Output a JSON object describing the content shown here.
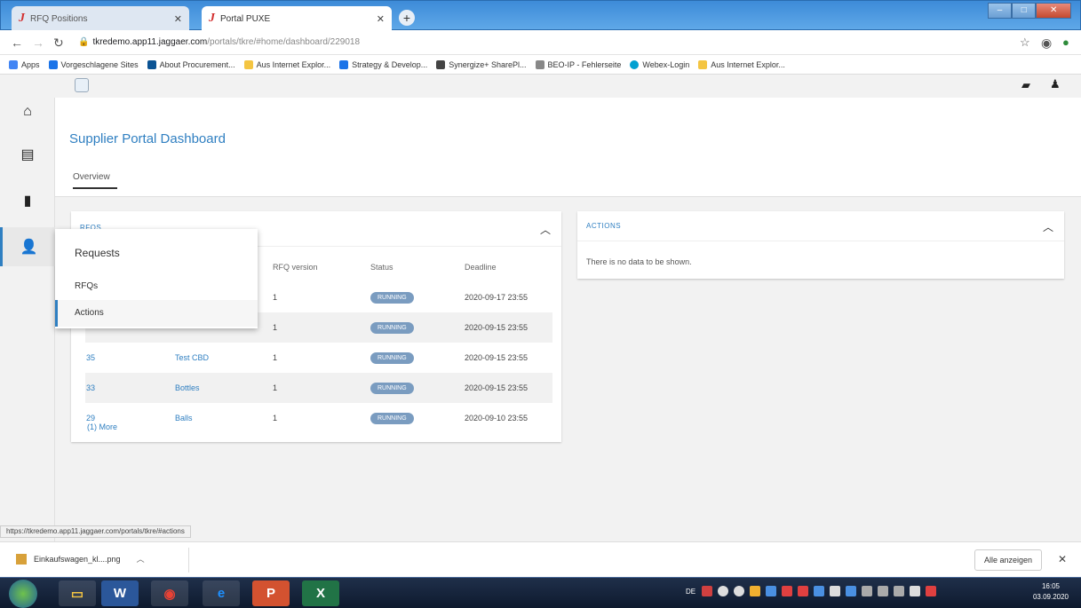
{
  "browser": {
    "tabs": [
      {
        "label": "RFQ Positions",
        "active": false
      },
      {
        "label": "Portal PUXE",
        "active": true
      }
    ],
    "url": {
      "host": "tkredemo.app11.jaggaer.com",
      "path": "/portals/tkre/#home/dashboard/229018"
    },
    "bookmarks": [
      {
        "label": "Apps",
        "color": "#4285f4"
      },
      {
        "label": "Vorgeschlagene Sites",
        "color": "#1a73e8"
      },
      {
        "label": "About Procurement...",
        "color": "#0b5394"
      },
      {
        "label": "Aus Internet Explor...",
        "color": "#f4c542"
      },
      {
        "label": "Strategy & Develop...",
        "color": "#1a73e8"
      },
      {
        "label": "Synergize+ SharePl...",
        "color": "#444444"
      },
      {
        "label": "BEO-IP - Fehlerseite",
        "color": "#888888"
      },
      {
        "label": "Webex-Login",
        "color": "#00a0d1"
      },
      {
        "label": "Aus Internet Explor...",
        "color": "#f4c542"
      }
    ]
  },
  "page": {
    "title": "Supplier Portal Dashboard",
    "overview_tab": "Overview"
  },
  "rfqs_card": {
    "title": "RFQS",
    "columns": [
      "RFQ version",
      "Status",
      "Deadline"
    ],
    "rows": [
      {
        "id": "",
        "name": "",
        "version": "1",
        "status": "RUNNING",
        "deadline": "2020-09-17 23:55"
      },
      {
        "id": "",
        "name": "",
        "version": "1",
        "status": "RUNNING",
        "deadline": "2020-09-15 23:55"
      },
      {
        "id": "35",
        "name": "Test CBD",
        "version": "1",
        "status": "RUNNING",
        "deadline": "2020-09-15 23:55"
      },
      {
        "id": "33",
        "name": "Bottles",
        "version": "1",
        "status": "RUNNING",
        "deadline": "2020-09-15 23:55"
      },
      {
        "id": "29",
        "name": "Balls",
        "version": "1",
        "status": "RUNNING",
        "deadline": "2020-09-10 23:55"
      }
    ],
    "more": "(1) More"
  },
  "actions_card": {
    "title": "ACTIONS",
    "empty_text": "There is no data to be shown."
  },
  "popup_menu": {
    "title": "Requests",
    "items": [
      {
        "label": "RFQs",
        "selected": false
      },
      {
        "label": "Actions",
        "selected": true
      }
    ]
  },
  "status_url": "https://tkredemo.app11.jaggaer.com/portals/tkre/#actions",
  "downloads": {
    "file": "Einkaufswagen_kl....png",
    "show_all": "Alle anzeigen"
  },
  "taskbar": {
    "lang": "DE",
    "time": "16:05",
    "date": "03.09.2020"
  },
  "colors": {
    "accent": "#2f7fc1",
    "badge": "#7a9cc0",
    "taskbar": "#1f2f4a"
  }
}
